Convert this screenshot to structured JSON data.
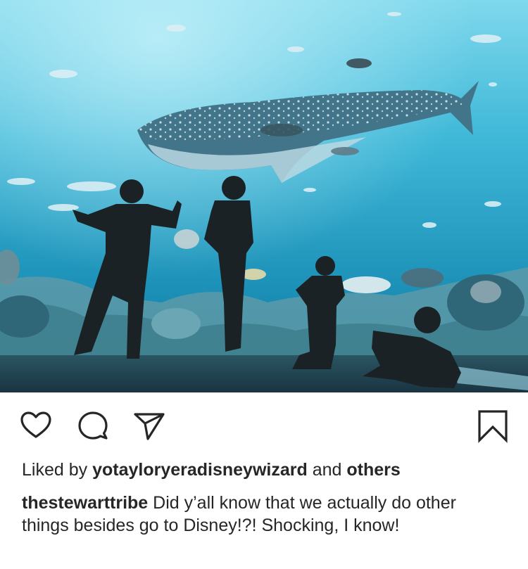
{
  "post": {
    "photo_alt": "Children watching a whale shark at an aquarium",
    "actions": {
      "like_icon": "heart-outline-icon",
      "comment_icon": "comment-bubble-icon",
      "share_icon": "paper-plane-icon",
      "save_icon": "bookmark-outline-icon"
    },
    "likes": {
      "prefix": "Liked by ",
      "user": "yotayloryeradisneywizard",
      "conjunction": " and ",
      "others": "others"
    },
    "caption": {
      "username": "thestewarttribe",
      "text": " Did y’all know that we actually do other things besides go to Disney!?! Shocking, I know!"
    }
  },
  "colors": {
    "text": "#262626",
    "icon_stroke": "#262626",
    "water_top": "#5cc9e3",
    "water_bottom": "#0d6f95"
  }
}
